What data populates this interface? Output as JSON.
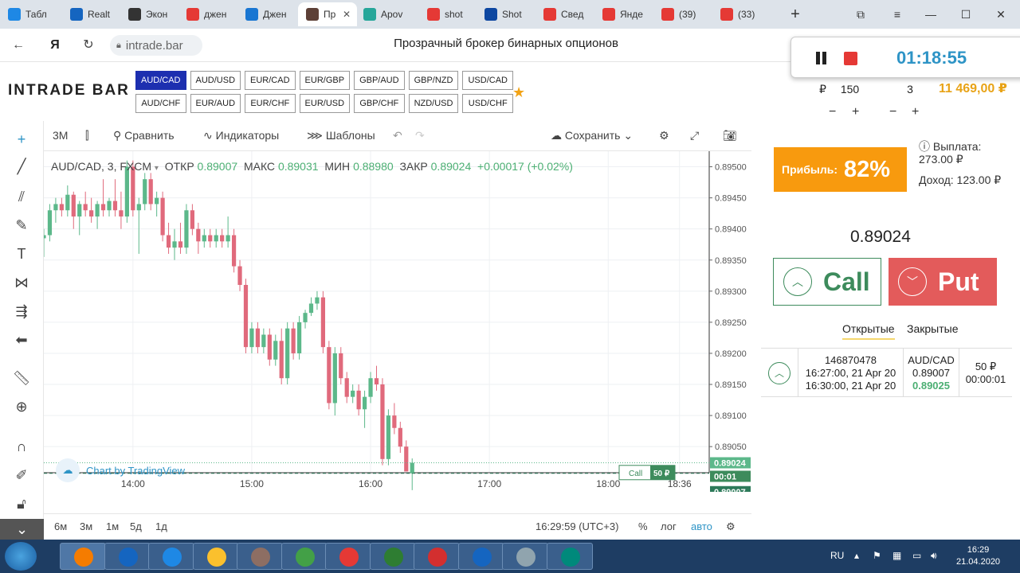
{
  "browser": {
    "tabs": [
      {
        "label": "Табл",
        "color": "#1e88e5"
      },
      {
        "label": "Realt",
        "color": "#1565c0"
      },
      {
        "label": "Экон",
        "color": "#333333"
      },
      {
        "label": "джен",
        "color": "#e53935"
      },
      {
        "label": "Джен",
        "color": "#1976d2"
      },
      {
        "label": "Пр",
        "color": "#5d4037",
        "active": true
      },
      {
        "label": "Apov",
        "color": "#26a69a"
      },
      {
        "label": "shot",
        "color": "#e53935"
      },
      {
        "label": "Shot",
        "color": "#0d47a1"
      },
      {
        "label": "Свед",
        "color": "#e53935"
      },
      {
        "label": "Янде",
        "color": "#e53935"
      },
      {
        "label": "(39)",
        "color": "#e53935"
      },
      {
        "label": "(33)",
        "color": "#e53935"
      }
    ],
    "url": "intrade.bar",
    "page_title": "Прозрачный брокер бинарных опционов"
  },
  "recorder": {
    "time": "01:18:55"
  },
  "header": {
    "logo": "INTRADE BAR",
    "pairs_row1": [
      "AUD/CAD",
      "AUD/USD",
      "EUR/CAD",
      "EUR/GBP",
      "GBP/AUD",
      "GBP/NZD",
      "USD/CAD"
    ],
    "pairs_row2": [
      "AUD/CHF",
      "EUR/AUD",
      "EUR/CHF",
      "EUR/USD",
      "GBP/CHF",
      "NZD/USD",
      "USD/CHF"
    ],
    "selected_pair": "AUD/CAD",
    "currency_symbol": "₽",
    "amount": "150",
    "duration": "3",
    "minus": "−",
    "plus": "+",
    "balance": "11 469,00 ₽"
  },
  "toolbar": {
    "interval": "3М",
    "compare": "Сравнить",
    "indicators": "Индикаторы",
    "templates": "Шаблоны",
    "save": "Сохранить"
  },
  "legend": {
    "symbol": "AUD/CAD, 3, FXCM",
    "open_label": "ОТКР",
    "open": "0.89007",
    "high_label": "МАКС",
    "high": "0.89031",
    "low_label": "МИН",
    "low": "0.88980",
    "close_label": "ЗАКР",
    "close": "0.89024",
    "change": "+0.00017 (+0.02%)"
  },
  "chart_data": {
    "type": "candlestick",
    "symbol": "AUD/CAD",
    "y_ticks": [
      "0.89500",
      "0.89450",
      "0.89400",
      "0.89350",
      "0.89300",
      "0.89250",
      "0.89200",
      "0.89150",
      "0.89100",
      "0.89050"
    ],
    "ylim": [
      0.89008,
      0.89525
    ],
    "x_ticks": [
      "14:00",
      "15:00",
      "16:00",
      "17:00",
      "18:00",
      "18:36"
    ],
    "x_tick_minutes": [
      840,
      900,
      960,
      1020,
      1080,
      1116
    ],
    "xlim_minutes": [
      795,
      1131
    ],
    "candle_minutes_start": 795,
    "candle_interval_minutes": 3,
    "candles": [
      [
        0.89385,
        0.894,
        0.89355,
        0.8939
      ],
      [
        0.8939,
        0.8944,
        0.8938,
        0.8943
      ],
      [
        0.8943,
        0.8945,
        0.8941,
        0.8944
      ],
      [
        0.8944,
        0.8945,
        0.8942,
        0.8943
      ],
      [
        0.8943,
        0.8947,
        0.8942,
        0.89455
      ],
      [
        0.89455,
        0.8946,
        0.894,
        0.8942
      ],
      [
        0.8942,
        0.89445,
        0.8939,
        0.8944
      ],
      [
        0.8944,
        0.8946,
        0.8942,
        0.8943
      ],
      [
        0.8943,
        0.8945,
        0.8941,
        0.8942
      ],
      [
        0.8942,
        0.89445,
        0.894,
        0.8944
      ],
      [
        0.8944,
        0.8948,
        0.8942,
        0.8943
      ],
      [
        0.8943,
        0.8945,
        0.8942,
        0.89445
      ],
      [
        0.89445,
        0.8948,
        0.8942,
        0.8943
      ],
      [
        0.8943,
        0.8946,
        0.894,
        0.8942
      ],
      [
        0.8942,
        0.8951,
        0.8941,
        0.895
      ],
      [
        0.895,
        0.8951,
        0.8942,
        0.8943
      ],
      [
        0.8943,
        0.8945,
        0.8936,
        0.8944
      ],
      [
        0.8944,
        0.8949,
        0.8943,
        0.8948
      ],
      [
        0.8948,
        0.8949,
        0.8943,
        0.8944
      ],
      [
        0.8944,
        0.8946,
        0.8942,
        0.8945
      ],
      [
        0.8945,
        0.8946,
        0.8938,
        0.8939
      ],
      [
        0.8939,
        0.8941,
        0.8936,
        0.8937
      ],
      [
        0.8937,
        0.894,
        0.8935,
        0.8938
      ],
      [
        0.8938,
        0.8941,
        0.8936,
        0.8937
      ],
      [
        0.8937,
        0.8944,
        0.8936,
        0.8943
      ],
      [
        0.8943,
        0.8944,
        0.8939,
        0.894
      ],
      [
        0.894,
        0.8941,
        0.8936,
        0.8938
      ],
      [
        0.8938,
        0.894,
        0.8937,
        0.8939
      ],
      [
        0.8939,
        0.894,
        0.8937,
        0.8938
      ],
      [
        0.8938,
        0.894,
        0.8937,
        0.8939
      ],
      [
        0.8939,
        0.894,
        0.8937,
        0.8938
      ],
      [
        0.8938,
        0.8942,
        0.8937,
        0.8939
      ],
      [
        0.8939,
        0.894,
        0.8933,
        0.8934
      ],
      [
        0.8934,
        0.8935,
        0.893,
        0.8931
      ],
      [
        0.8931,
        0.8932,
        0.892,
        0.8921
      ],
      [
        0.8921,
        0.8925,
        0.892,
        0.8924
      ],
      [
        0.8924,
        0.8925,
        0.892,
        0.8921
      ],
      [
        0.8921,
        0.8924,
        0.892,
        0.8923
      ],
      [
        0.8923,
        0.8924,
        0.8918,
        0.8919
      ],
      [
        0.8919,
        0.8923,
        0.8918,
        0.8922
      ],
      [
        0.8922,
        0.8924,
        0.8915,
        0.8916
      ],
      [
        0.8916,
        0.8925,
        0.8915,
        0.8924
      ],
      [
        0.8924,
        0.8925,
        0.8919,
        0.892
      ],
      [
        0.892,
        0.8926,
        0.8919,
        0.8925
      ],
      [
        0.8925,
        0.8927,
        0.8924,
        0.89265
      ],
      [
        0.89265,
        0.8929,
        0.8926,
        0.8928
      ],
      [
        0.8928,
        0.893,
        0.8927,
        0.8929
      ],
      [
        0.8929,
        0.893,
        0.892,
        0.8921
      ],
      [
        0.8921,
        0.8922,
        0.8911,
        0.8912
      ],
      [
        0.8912,
        0.8921,
        0.891,
        0.892
      ],
      [
        0.892,
        0.8921,
        0.8915,
        0.8916
      ],
      [
        0.8916,
        0.8917,
        0.8912,
        0.8913
      ],
      [
        0.8913,
        0.8915,
        0.8912,
        0.8914
      ],
      [
        0.8914,
        0.8915,
        0.891,
        0.8911
      ],
      [
        0.8911,
        0.8914,
        0.8908,
        0.8913
      ],
      [
        0.8913,
        0.8917,
        0.8912,
        0.8916
      ],
      [
        0.8916,
        0.8918,
        0.8914,
        0.8915
      ],
      [
        0.8915,
        0.8916,
        0.8902,
        0.8903
      ],
      [
        0.8903,
        0.8911,
        0.8902,
        0.891
      ],
      [
        0.891,
        0.8912,
        0.8907,
        0.8908
      ],
      [
        0.8908,
        0.8909,
        0.8904,
        0.8905
      ],
      [
        0.8905,
        0.8906,
        0.8901,
        0.8901
      ],
      [
        0.89007,
        0.89031,
        0.8898,
        0.89024
      ]
    ],
    "price_labels": [
      "0.89024",
      "00:01",
      "0.89007"
    ],
    "position_marker": {
      "side": "Call",
      "amount": "50 ₽"
    },
    "grid": true,
    "colors": {
      "up": "#5cb88a",
      "down": "#e06a7c"
    }
  },
  "branding": {
    "tradingview": "Chart by TradingView"
  },
  "bottombar": {
    "ranges": [
      "6м",
      "3м",
      "1м",
      "5д",
      "1д"
    ],
    "clock": "16:29:59 (UTC+3)",
    "percent": "%",
    "log": "лог",
    "auto": "авто"
  },
  "panel": {
    "profit_label": "Прибыль:",
    "profit_value": "82%",
    "payout": "Выплата: 273.00 ₽",
    "income": "Доход: 123.00 ₽",
    "current_price": "0.89024",
    "call_label": "Call",
    "put_label": "Put",
    "tab_open": "Открытые",
    "tab_closed": "Закрытые",
    "trade": {
      "id": "146870478",
      "open_time": "16:27:00, 21 Apr 20",
      "close_time": "16:30:00, 21 Apr 20",
      "pair": "AUD/CAD",
      "open_price": "0.89007",
      "current_price": "0.89025",
      "amount": "50 ₽",
      "remaining": "00:00:01"
    }
  },
  "taskbar": {
    "lang": "RU",
    "time": "16:29",
    "date": "21.04.2020"
  }
}
